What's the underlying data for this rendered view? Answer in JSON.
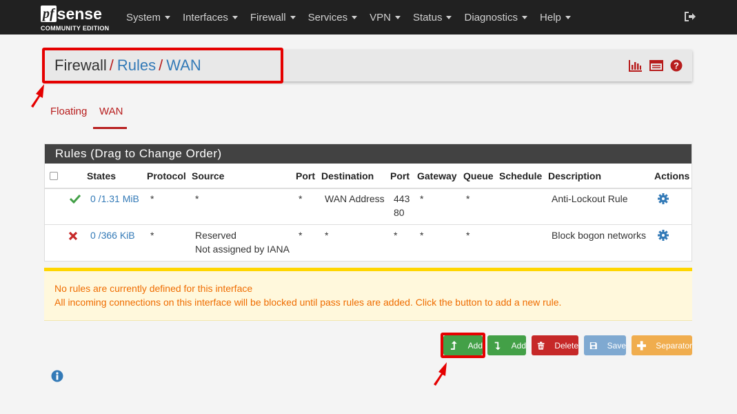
{
  "navbar": {
    "logo_pf": "pf",
    "logo_sense": "sense",
    "logo_sub": "COMMUNITY EDITION",
    "menu": [
      "System",
      "Interfaces",
      "Firewall",
      "Services",
      "VPN",
      "Status",
      "Diagnostics",
      "Help"
    ]
  },
  "breadcrumb": {
    "root": "Firewall",
    "sep": "/",
    "level1": "Rules",
    "level2": "WAN"
  },
  "tabs": {
    "floating": "Floating",
    "wan": "WAN"
  },
  "panel": {
    "title": "Rules (Drag to Change Order)",
    "headers": {
      "states": "States",
      "protocol": "Protocol",
      "source": "Source",
      "port": "Port",
      "destination": "Destination",
      "port2": "Port",
      "gateway": "Gateway",
      "queue": "Queue",
      "schedule": "Schedule",
      "description": "Description",
      "actions": "Actions"
    },
    "rows": [
      {
        "status": "pass",
        "states": "0 /1.31 MiB",
        "protocol": "*",
        "source": "*",
        "source2": "",
        "port": "*",
        "destination": "WAN Address",
        "port2": "443",
        "port2b": "80",
        "gateway": "*",
        "queue": "*",
        "schedule": "",
        "description": "Anti-Lockout Rule"
      },
      {
        "status": "block",
        "states": "0 /366 KiB",
        "protocol": "*",
        "source": "Reserved",
        "source2": "Not assigned by IANA",
        "port": "*",
        "destination": "*",
        "port2": "*",
        "port2b": "",
        "gateway": "*",
        "queue": "*",
        "schedule": "",
        "description": "Block bogon networks"
      }
    ]
  },
  "alert": {
    "line1": "No rules are currently defined for this interface",
    "line2": "All incoming connections on this interface will be blocked until pass rules are added. Click the button to add a new rule."
  },
  "buttons": {
    "add_top": "Add",
    "add_bottom": "Add",
    "delete": "Delete",
    "save": "Save",
    "separator": "Separator"
  },
  "colors": {
    "navbar": "#212121",
    "accent_red": "#b71c1c",
    "link_blue": "#337ab7",
    "highlight": "#e50000",
    "alert_text": "#ef6c00"
  },
  "icons": {
    "logout": "sign-out-icon",
    "chart": "bar-chart-icon",
    "table": "table-icon",
    "help": "question-circle-icon",
    "pass": "check-icon",
    "block": "times-icon",
    "action": "gear-icon",
    "info": "info-circle-icon"
  }
}
